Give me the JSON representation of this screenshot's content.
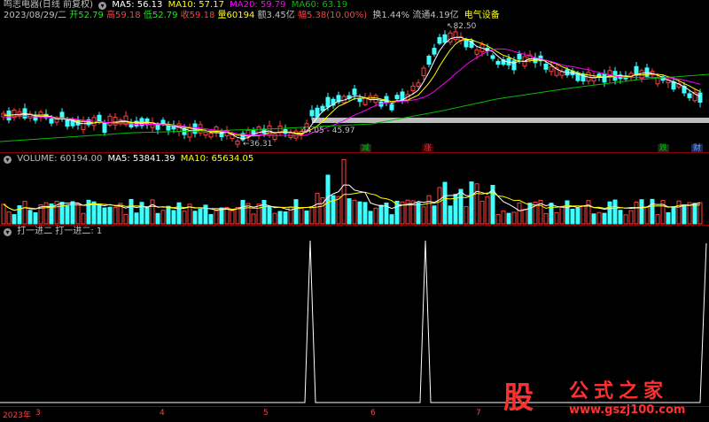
{
  "price": {
    "line1": {
      "name": "鸣志电器(日线 前复权)",
      "ma5_label": "MA5: 56.13",
      "ma10_label": "MA10: 57.17",
      "ma20_label": "MA20: 59.79",
      "ma60_label": "MA60: 63.19"
    },
    "line2": {
      "date": "2023/08/29/二",
      "open": "开52.79",
      "high": "高59.18",
      "low": "低52.79",
      "close": "收59.18",
      "vol": "量60194",
      "amount": "额3.45亿",
      "change": "幅5.38(10.00%)",
      "turnover": "换1.44%",
      "float": "流通4.19亿",
      "sector": "电气设备"
    },
    "annotations": {
      "high_mark": "82.50",
      "low_mark": "36.31",
      "range_mark": "44.05 - 45.97"
    },
    "tags": [
      {
        "text": "减",
        "color": "#00c000"
      },
      {
        "text": "涨",
        "color": "#ff3030"
      },
      {
        "text": "跌",
        "color": "#00c000"
      },
      {
        "text": "财",
        "color": "#3a7bff"
      }
    ]
  },
  "volume": {
    "label": "VOLUME: 60194.00",
    "ma5_label": "MA5: 53841.39",
    "ma10_label": "MA10: 65634.05"
  },
  "indicator": {
    "label": "打一进二 打一进二: 1"
  },
  "axis": {
    "year": "2023年",
    "ticks": [
      "3",
      "4",
      "5",
      "6",
      "7"
    ]
  },
  "watermark": {
    "glyph": "股",
    "title": "公式之家",
    "url": "www.gszj100.com"
  },
  "colors": {
    "up": "#ff4040",
    "down": "#40ffff",
    "ma5": "#ffffff",
    "ma10": "#ffff00",
    "ma20": "#ff00ff",
    "ma60": "#00c000"
  }
}
